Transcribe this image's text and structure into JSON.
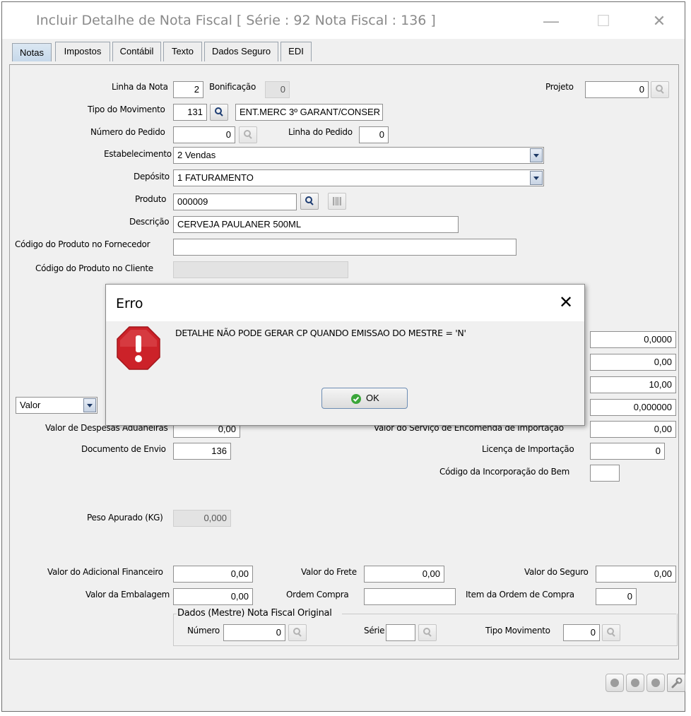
{
  "window": {
    "title": "Incluir Detalhe de Nota Fiscal [ Série : 92 Nota Fiscal : 136 ]",
    "minimize": "—",
    "maximize": "☐",
    "close": "✕"
  },
  "tabs": [
    {
      "label": "Notas",
      "active": true
    },
    {
      "label": "Impostos",
      "active": false
    },
    {
      "label": "Contábil",
      "active": false
    },
    {
      "label": "Texto",
      "active": false
    },
    {
      "label": "Dados Seguro",
      "active": false
    },
    {
      "label": "EDI",
      "active": false
    }
  ],
  "form": {
    "linha_nota_label": "Linha da Nota",
    "linha_nota_value": "2",
    "bonificacao_label": "Bonificação",
    "bonificacao_value": "0",
    "projeto_label": "Projeto",
    "projeto_value": "0",
    "tipo_mov_label": "Tipo do Movimento",
    "tipo_mov_value": "131",
    "tipo_mov_desc": "ENT.MERC 3º GARANT/CONSER",
    "num_pedido_label": "Número do Pedido",
    "num_pedido_value": "0",
    "linha_pedido_label": "Linha do Pedido",
    "linha_pedido_value": "0",
    "estab_label": "Estabelecimento",
    "estab_value": "2 Vendas",
    "deposito_label": "Depósito",
    "deposito_value": "1 FATURAMENTO",
    "produto_label": "Produto",
    "produto_value": "000009",
    "descricao_label": "Descrição",
    "descricao_value": "CERVEJA PAULANER 500ML",
    "cod_fornecedor_label": "Código do Produto no Fornecedor",
    "cod_fornecedor_value": "",
    "cod_cliente_label": "Código do Produto no Cliente",
    "cod_cliente_value": "",
    "valor_select": "Valor",
    "right_val_1": "0,0000",
    "right_val_2": "0,00",
    "right_val_3": "10,00",
    "right_val_4": "0,000000",
    "desp_aduaneiras_label": "Valor de Despesas Aduaneiras",
    "desp_aduaneiras_value": "0,00",
    "servico_encomenda_label": "Valor do Serviço de Encomenda de Importação",
    "servico_encomenda_value": "0,00",
    "doc_envio_label": "Documento de Envio",
    "doc_envio_value": "136",
    "licenca_label": "Licença de Importação",
    "licenca_value": "0",
    "incorporacao_label": "Código da Incorporação do Bem",
    "incorporacao_value": "",
    "peso_label": "Peso Apurado (KG)",
    "peso_value": "0,000",
    "adic_fin_label": "Valor do Adicional Financeiro",
    "adic_fin_value": "0,00",
    "frete_label": "Valor do Frete",
    "frete_value": "0,00",
    "seguro_label": "Valor do Seguro",
    "seguro_value": "0,00",
    "embalagem_label": "Valor da Embalagem",
    "embalagem_value": "0,00",
    "ordem_compra_label": "Ordem Compra",
    "ordem_compra_value": "",
    "item_ordem_label": "Item da Ordem de Compra",
    "item_ordem_value": "0"
  },
  "mestre_group": {
    "title": "Dados (Mestre) Nota Fiscal Original",
    "numero_label": "Número",
    "numero_value": "0",
    "serie_label": "Série",
    "serie_value": "",
    "tipo_mov_label": "Tipo Movimento",
    "tipo_mov_value": "0"
  },
  "dialog": {
    "title": "Erro",
    "message": "DETALHE NÃO PODE GERAR CP QUANDO EMISSAO DO MESTRE = 'N'",
    "ok_label": "OK",
    "close": "✕"
  },
  "colors": {
    "error_red": "#cc2229",
    "ok_green": "#3aa63a"
  }
}
